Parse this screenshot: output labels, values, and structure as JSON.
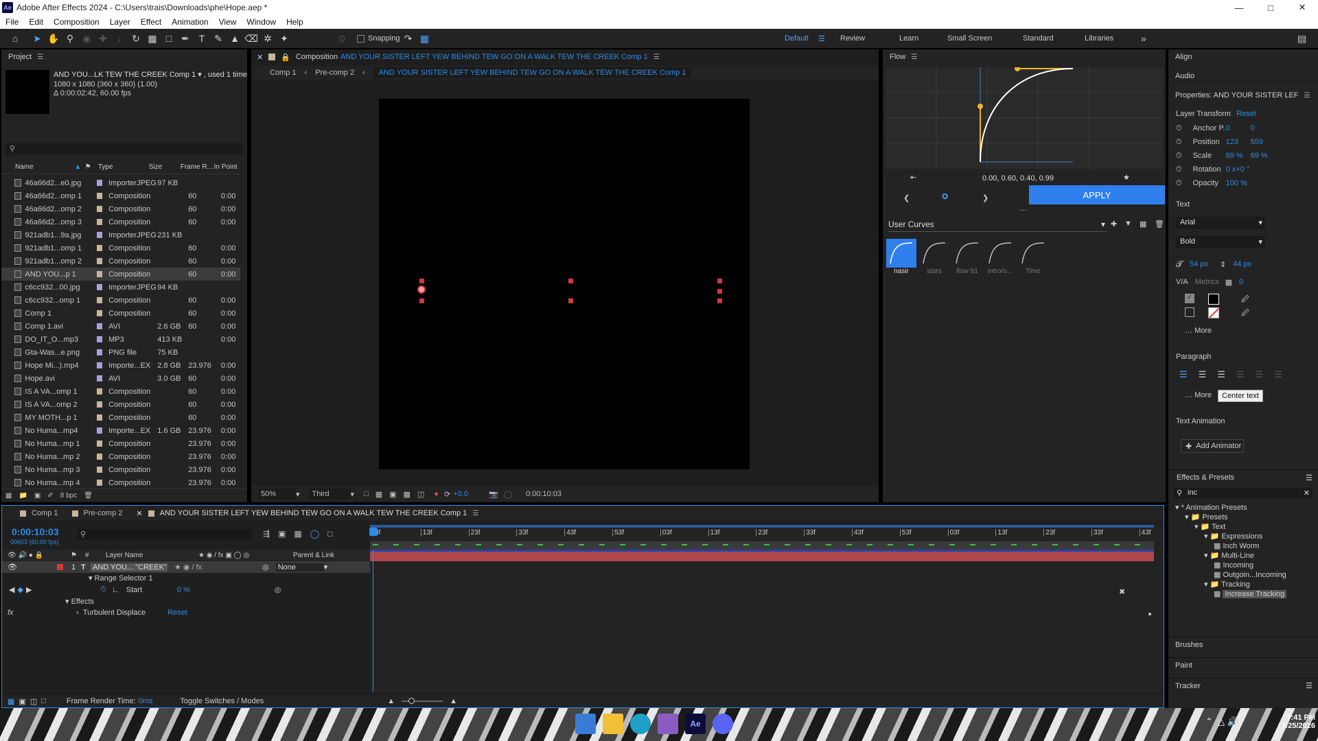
{
  "window": {
    "title": "Adobe After Effects 2024 - C:\\Users\\trais\\Downloads\\phe\\Hope.aep *",
    "app_icon": "Ae"
  },
  "menu": [
    "File",
    "Edit",
    "Composition",
    "Layer",
    "Effect",
    "Animation",
    "View",
    "Window",
    "Help"
  ],
  "toolbar": {
    "snapping_label": "Snapping",
    "workspaces": [
      "Default",
      "Review",
      "Learn",
      "Small Screen",
      "Standard",
      "Libraries"
    ],
    "active_workspace": "Default"
  },
  "project": {
    "title": "Project",
    "selected_name": "AND YOU...LK TEW THE CREEK Comp 1",
    "used_count": ", used 1 time",
    "dims": "1080 x 1080  (360 x 360) (1.00)",
    "duration": "Δ 0:00:02:42, 60.00 fps",
    "search_placeholder": "",
    "columns": [
      "Name",
      "Type",
      "Size",
      "Frame R...",
      "In Point"
    ],
    "bpc": "8 bpc",
    "items": [
      {
        "name": "46a66d2...e0.jpg",
        "type": "ImporterJPEG",
        "size": "97 KB",
        "fps": "",
        "in": "",
        "color": "#a8a0d8",
        "icon": "image"
      },
      {
        "name": "46a66d2...omp 1",
        "type": "Composition",
        "size": "",
        "fps": "60",
        "in": "0:00",
        "color": "#c8b59a",
        "icon": "comp"
      },
      {
        "name": "46a66d2...omp 2",
        "type": "Composition",
        "size": "",
        "fps": "60",
        "in": "0:00",
        "color": "#c8b59a",
        "icon": "comp"
      },
      {
        "name": "46a66d2...omp 3",
        "type": "Composition",
        "size": "",
        "fps": "60",
        "in": "0:00",
        "color": "#c8b59a",
        "icon": "comp"
      },
      {
        "name": "921adb1...9a.jpg",
        "type": "ImporterJPEG",
        "size": "231 KB",
        "fps": "",
        "in": "",
        "color": "#a8a0d8",
        "icon": "image"
      },
      {
        "name": "921adb1...omp 1",
        "type": "Composition",
        "size": "",
        "fps": "60",
        "in": "0:00",
        "color": "#c8b59a",
        "icon": "comp"
      },
      {
        "name": "921adb1...omp 2",
        "type": "Composition",
        "size": "",
        "fps": "60",
        "in": "0:00",
        "color": "#c8b59a",
        "icon": "comp"
      },
      {
        "name": "AND YOU...p 1",
        "type": "Composition",
        "size": "",
        "fps": "60",
        "in": "0:00",
        "color": "#c8b59a",
        "icon": "comp",
        "selected": true
      },
      {
        "name": "c6cc932...00.jpg",
        "type": "ImporterJPEG",
        "size": "94 KB",
        "fps": "",
        "in": "",
        "color": "#a8a0d8",
        "icon": "image"
      },
      {
        "name": "c6cc932...omp 1",
        "type": "Composition",
        "size": "",
        "fps": "60",
        "in": "0:00",
        "color": "#c8b59a",
        "icon": "comp"
      },
      {
        "name": "Comp 1",
        "type": "Composition",
        "size": "",
        "fps": "60",
        "in": "0:00",
        "color": "#c8b59a",
        "icon": "comp"
      },
      {
        "name": "Comp 1.avi",
        "type": "AVI",
        "size": "2.6 GB",
        "fps": "60",
        "in": "0:00",
        "color": "#a8a0d8",
        "icon": "media"
      },
      {
        "name": "DO_IT_O...mp3",
        "type": "MP3",
        "size": "413 KB",
        "fps": "",
        "in": "0:00",
        "color": "#a8a0d8",
        "icon": "media"
      },
      {
        "name": "Gta-Was...e.png",
        "type": "PNG file",
        "size": "75 KB",
        "fps": "",
        "in": "",
        "color": "#a8a0d8",
        "icon": "image"
      },
      {
        "name": "Hope Mi...).mp4",
        "type": "Importe...EX",
        "size": "2.8 GB",
        "fps": "23.976",
        "in": "0:00",
        "color": "#a8a0d8",
        "icon": "media"
      },
      {
        "name": "Hope.avi",
        "type": "AVI",
        "size": "3.0 GB",
        "fps": "60",
        "in": "0:00",
        "color": "#a8a0d8",
        "icon": "media"
      },
      {
        "name": "IS A VA...omp 1",
        "type": "Composition",
        "size": "",
        "fps": "60",
        "in": "0:00",
        "color": "#c8b59a",
        "icon": "comp"
      },
      {
        "name": "IS A VA...omp 2",
        "type": "Composition",
        "size": "",
        "fps": "60",
        "in": "0:00",
        "color": "#c8b59a",
        "icon": "comp"
      },
      {
        "name": "MY MOTH...p 1",
        "type": "Composition",
        "size": "",
        "fps": "60",
        "in": "0:00",
        "color": "#c8b59a",
        "icon": "comp"
      },
      {
        "name": "No Huma...mp4",
        "type": "Importe...EX",
        "size": "1.6 GB",
        "fps": "23.976",
        "in": "0:00",
        "color": "#a8a0d8",
        "icon": "media"
      },
      {
        "name": "No Huma...mp 1",
        "type": "Composition",
        "size": "",
        "fps": "23.976",
        "in": "0:00",
        "color": "#c8b59a",
        "icon": "comp"
      },
      {
        "name": "No Huma...mp 2",
        "type": "Composition",
        "size": "",
        "fps": "23.976",
        "in": "0:00",
        "color": "#c8b59a",
        "icon": "comp"
      },
      {
        "name": "No Huma...mp 3",
        "type": "Composition",
        "size": "",
        "fps": "23.976",
        "in": "0:00",
        "color": "#c8b59a",
        "icon": "comp"
      },
      {
        "name": "No Huma...mp 4",
        "type": "Composition",
        "size": "",
        "fps": "23.976",
        "in": "0:00",
        "color": "#c8b59a",
        "icon": "comp"
      }
    ]
  },
  "composition": {
    "panel_label": "Composition",
    "panel_name": "AND YOUR SISTER LEFT YEW BEHIND TEW GO ON A WALK TEW THE CREEK Comp 1",
    "breadcrumbs": [
      "Comp 1",
      "Pre-comp 2",
      "AND YOUR SISTER LEFT YEW BEHIND TEW GO ON A WALK TEW THE CREEK Comp 1"
    ],
    "zoom": "50%",
    "resolution": "Third",
    "exposure": "+0.0",
    "timecode": "0:00:10:03"
  },
  "flow": {
    "title": "Flow",
    "values": "0.00, 0.60, 0.40, 0.99",
    "apply_label": "APPLY",
    "curves_label": "User Curves",
    "presets": [
      "nasir",
      "stars",
      "flow b1",
      "intro/o...",
      "Time"
    ]
  },
  "properties": {
    "align": "Align",
    "audio": "Audio",
    "title": "Properties: AND YOUR SISTER LEF",
    "layer_transform": "Layer Transform",
    "reset": "Reset",
    "anchor_label": "Anchor P.",
    "anchor": [
      "0",
      "0"
    ],
    "position_label": "Position",
    "position": [
      "123",
      "559"
    ],
    "scale_label": "Scale",
    "scale": [
      "69 %",
      "69 %"
    ],
    "rotation_label": "Rotation",
    "rotation": "0 x+0 °",
    "opacity_label": "Opacity",
    "opacity": "100 %",
    "text_section": "Text",
    "font": "Arial",
    "style": "Bold",
    "font_size": "54 px",
    "leading": "44 px",
    "kerning": "Metrics",
    "tracking": "0",
    "more": "More",
    "paragraph": "Paragraph",
    "paragraph_more": "More",
    "tooltip": "Center text",
    "text_animation": "Text Animation",
    "add_animator": "Add Animator"
  },
  "effects": {
    "title": "Effects & Presets",
    "search": "inc",
    "tree": [
      {
        "label": "* Animation Presets",
        "level": 0
      },
      {
        "label": "Presets",
        "level": 1
      },
      {
        "label": "Text",
        "level": 2
      },
      {
        "label": "Expressions",
        "level": 3
      },
      {
        "label": "Inch Worm",
        "level": 4
      },
      {
        "label": "Multi-Line",
        "level": 3
      },
      {
        "label": "Incoming",
        "level": 4
      },
      {
        "label": "Outgoin...Incoming",
        "level": 4
      },
      {
        "label": "Tracking",
        "level": 3
      },
      {
        "label": "Increase Tracking",
        "level": 4,
        "selected": true
      }
    ]
  },
  "side_panels": [
    "Brushes",
    "Paint",
    "Tracker"
  ],
  "timeline": {
    "tabs": [
      "Comp 1",
      "Pre-comp 2",
      "AND YOUR SISTER LEFT YEW BEHIND TEW GO ON A WALK TEW THE CREEK Comp 1"
    ],
    "timecode": "0:00:10:03",
    "frame_info": "00603 (60.00 fps)",
    "col_layer_name": "Layer Name",
    "col_parent": "Parent & Link",
    "col_num": "#",
    "layer_num": "1",
    "layer_name": "AND YOU... \"CREEK\"",
    "parent": "None",
    "range_selector": "Range Selector 1",
    "start_label": "Start",
    "start_value": "0 %",
    "effects_label": "Effects",
    "effect_name": "Turbulent Displace",
    "effect_reset": "Reset",
    "ruler": [
      "3f",
      "13f",
      "23f",
      "33f",
      "43f",
      "53f",
      "03f",
      "13f",
      "23f",
      "33f",
      "43f",
      "53f",
      "03f",
      "13f",
      "23f",
      "33f",
      "43f"
    ],
    "frame_render": "Frame Render Time:",
    "frame_render_val": "0ms",
    "toggle": "Toggle Switches / Modes"
  },
  "taskbar": {
    "time": "7:41 PM",
    "date": "7/25/2026"
  },
  "colors": {
    "accent": "#2d8ceb",
    "panel": "#232323",
    "layer_bar": "#b0474c",
    "flow_curve": "#f0b429",
    "apply": "#2f80ed"
  }
}
